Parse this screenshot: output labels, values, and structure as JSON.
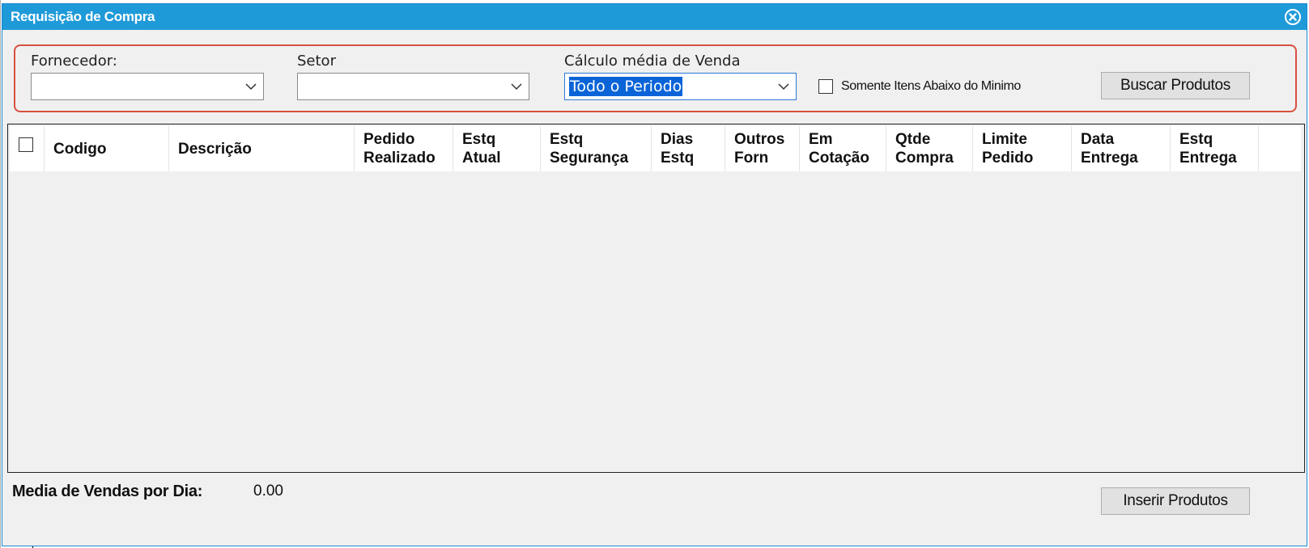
{
  "window": {
    "title": "Requisição de Compra"
  },
  "filters": {
    "fornecedor": {
      "label": "Fornecedor:",
      "value": ""
    },
    "setor": {
      "label": "Setor",
      "value": ""
    },
    "calculo": {
      "label": "Cálculo média de Venda",
      "value": "Todo o Periodo"
    },
    "checkbox": {
      "label": "Somente Itens Abaixo do Minimo",
      "checked": false
    },
    "search_button": "Buscar Produtos"
  },
  "grid": {
    "columns": [
      {
        "line1": "Codigo",
        "line2": ""
      },
      {
        "line1": "Descrição",
        "line2": ""
      },
      {
        "line1": "Pedido",
        "line2": "Realizado"
      },
      {
        "line1": "Estq",
        "line2": "Atual"
      },
      {
        "line1": "Estq",
        "line2": "Segurança"
      },
      {
        "line1": "Dias",
        "line2": "Estq"
      },
      {
        "line1": "Outros",
        "line2": "Forn"
      },
      {
        "line1": "Em",
        "line2": "Cotação"
      },
      {
        "line1": "Qtde",
        "line2": "Compra"
      },
      {
        "line1": "Limite",
        "line2": "Pedido"
      },
      {
        "line1": "Data",
        "line2": "Entrega"
      },
      {
        "line1": "Estq",
        "line2": "Entrega"
      }
    ],
    "rows": []
  },
  "footer": {
    "media_label": "Media de Vendas por Dia:",
    "media_value": "0.00",
    "insert_button": "Inserir Produtos"
  }
}
